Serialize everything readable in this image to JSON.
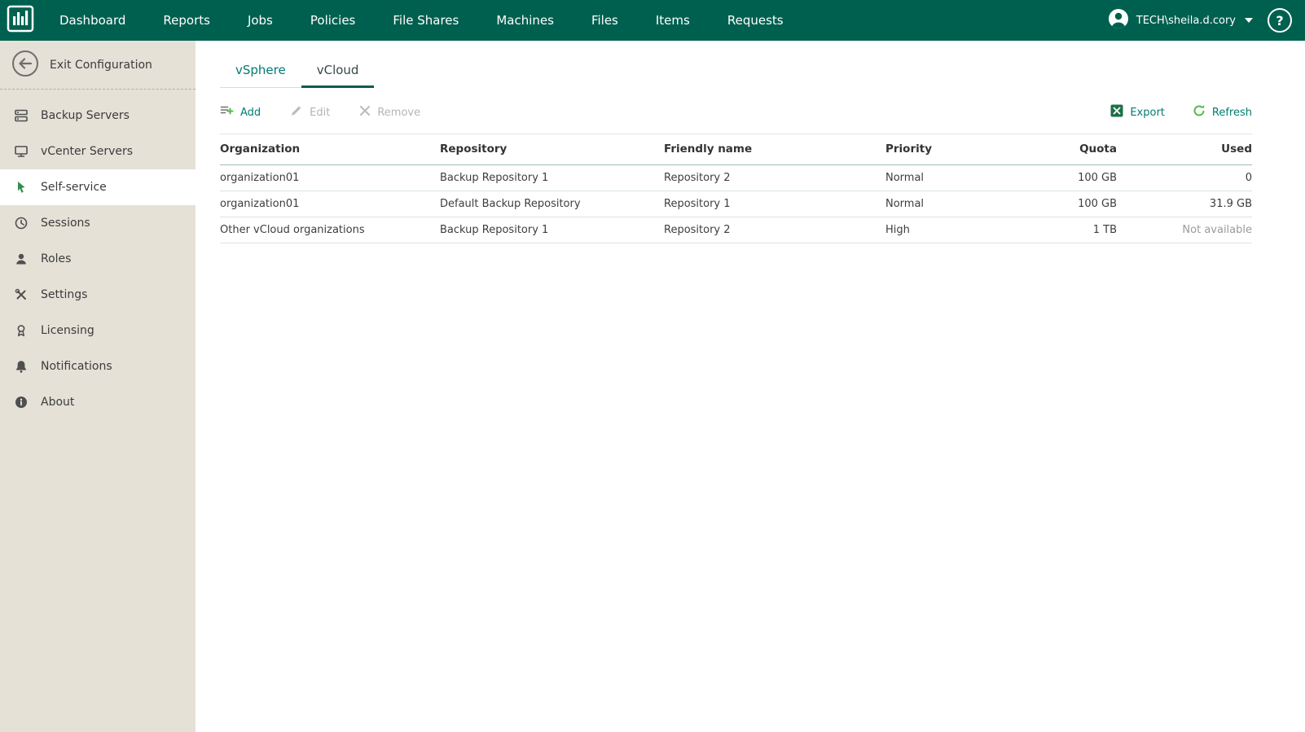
{
  "theme": {
    "brand_green": "#00604F",
    "accent_teal": "#007C74",
    "icon_green": "#54B948",
    "sidebar_bg": "#E5E1D7"
  },
  "topbar": {
    "nav": [
      "Dashboard",
      "Reports",
      "Jobs",
      "Policies",
      "File Shares",
      "Machines",
      "Files",
      "Items",
      "Requests"
    ],
    "user_name": "TECH\\sheila.d.cory",
    "help_label": "?"
  },
  "sidebar": {
    "exit_label": "Exit Configuration",
    "items": [
      {
        "label": "Backup Servers",
        "icon": "backup-servers-icon",
        "active": false
      },
      {
        "label": "vCenter Servers",
        "icon": "vcenter-servers-icon",
        "active": false
      },
      {
        "label": "Self-service",
        "icon": "self-service-icon",
        "active": true
      },
      {
        "label": "Sessions",
        "icon": "sessions-icon",
        "active": false
      },
      {
        "label": "Roles",
        "icon": "roles-icon",
        "active": false
      },
      {
        "label": "Settings",
        "icon": "settings-icon",
        "active": false
      },
      {
        "label": "Licensing",
        "icon": "licensing-icon",
        "active": false
      },
      {
        "label": "Notifications",
        "icon": "notifications-icon",
        "active": false
      },
      {
        "label": "About",
        "icon": "about-icon",
        "active": false
      }
    ]
  },
  "main": {
    "tabs": [
      {
        "label": "vSphere",
        "active": false
      },
      {
        "label": "vCloud",
        "active": true
      }
    ],
    "toolbar": {
      "add": "Add",
      "edit": "Edit",
      "remove": "Remove",
      "export": "Export",
      "refresh": "Refresh"
    },
    "table": {
      "columns": [
        "Organization",
        "Repository",
        "Friendly name",
        "Priority",
        "Quota",
        "Used"
      ],
      "rows": [
        {
          "organization": "organization01",
          "repository": "Backup Repository 1",
          "friendly_name": "Repository 2",
          "priority": "Normal",
          "quota": "100 GB",
          "used": "0"
        },
        {
          "organization": "organization01",
          "repository": "Default Backup Repository",
          "friendly_name": "Repository 1",
          "priority": "Normal",
          "quota": "100 GB",
          "used": "31.9 GB"
        },
        {
          "organization": "Other vCloud organizations",
          "repository": "Backup Repository 1",
          "friendly_name": "Repository 2",
          "priority": "High",
          "quota": "1 TB",
          "used": "Not available"
        }
      ]
    }
  }
}
